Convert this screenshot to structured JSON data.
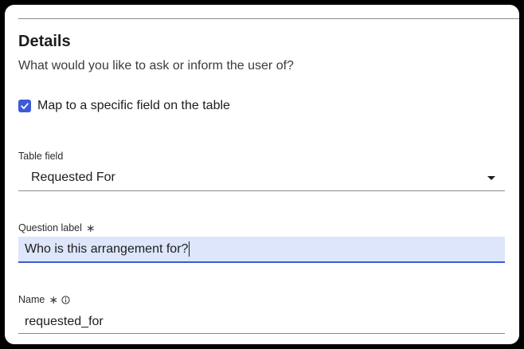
{
  "details": {
    "title": "Details",
    "description": "What would you like to ask or inform the user of?",
    "map_checkbox": {
      "label": "Map to a specific field on the table",
      "checked": true
    },
    "table_field": {
      "label": "Table field",
      "value": "Requested For",
      "icon": "chevron-down-icon"
    },
    "question_label": {
      "label": "Question label",
      "required_marker": "∗",
      "value": "Who is this arrangement for?"
    },
    "name": {
      "label": "Name",
      "required_marker": "∗",
      "info_icon": "info-icon",
      "value": "requested_for"
    }
  },
  "colors": {
    "accent": "#3d5ad8",
    "active_field_bg": "#dde6fa",
    "divider": "#8a8a8a"
  }
}
